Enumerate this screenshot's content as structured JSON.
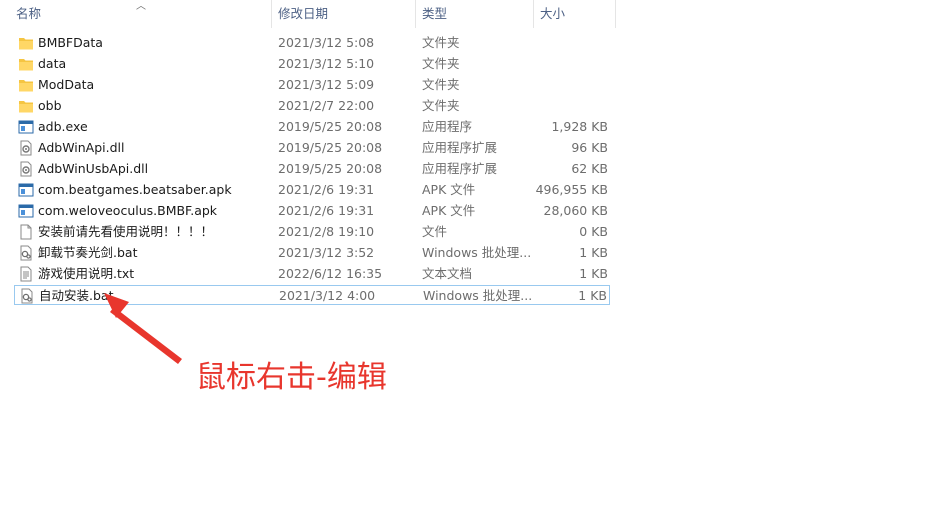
{
  "columns": {
    "name": "名称",
    "date": "修改日期",
    "type": "类型",
    "size": "大小"
  },
  "files": [
    {
      "name": "BMBFData",
      "date": "2021/3/12 5:08",
      "type": "文件夹",
      "size": "",
      "icon": "folder-icon"
    },
    {
      "name": "data",
      "date": "2021/3/12 5:10",
      "type": "文件夹",
      "size": "",
      "icon": "folder-icon"
    },
    {
      "name": "ModData",
      "date": "2021/3/12 5:09",
      "type": "文件夹",
      "size": "",
      "icon": "folder-icon"
    },
    {
      "name": "obb",
      "date": "2021/2/7 22:00",
      "type": "文件夹",
      "size": "",
      "icon": "folder-icon"
    },
    {
      "name": "adb.exe",
      "date": "2019/5/25 20:08",
      "type": "应用程序",
      "size": "1,928 KB",
      "icon": "exe-icon"
    },
    {
      "name": "AdbWinApi.dll",
      "date": "2019/5/25 20:08",
      "type": "应用程序扩展",
      "size": "96 KB",
      "icon": "dll-icon"
    },
    {
      "name": "AdbWinUsbApi.dll",
      "date": "2019/5/25 20:08",
      "type": "应用程序扩展",
      "size": "62 KB",
      "icon": "dll-icon"
    },
    {
      "name": "com.beatgames.beatsaber.apk",
      "date": "2021/2/6 19:31",
      "type": "APK 文件",
      "size": "496,955 KB",
      "icon": "apk-icon"
    },
    {
      "name": "com.weloveoculus.BMBF.apk",
      "date": "2021/2/6 19:31",
      "type": "APK 文件",
      "size": "28,060 KB",
      "icon": "apk-icon"
    },
    {
      "name": "安装前请先看使用说明！！！！",
      "date": "2021/2/8 19:10",
      "type": "文件",
      "size": "0 KB",
      "icon": "blank-file-icon"
    },
    {
      "name": "卸载节奏光剑.bat",
      "date": "2021/3/12 3:52",
      "type": "Windows 批处理...",
      "size": "1 KB",
      "icon": "bat-icon"
    },
    {
      "name": "游戏使用说明.txt",
      "date": "2022/6/12 16:35",
      "type": "文本文档",
      "size": "1 KB",
      "icon": "txt-icon"
    },
    {
      "name": "自动安装.bat",
      "date": "2021/3/12 4:00",
      "type": "Windows 批处理...",
      "size": "1 KB",
      "icon": "bat-icon"
    }
  ],
  "selected_index": 12,
  "annotation": {
    "text": "鼠标右击-编辑",
    "color": "#e8362d"
  }
}
